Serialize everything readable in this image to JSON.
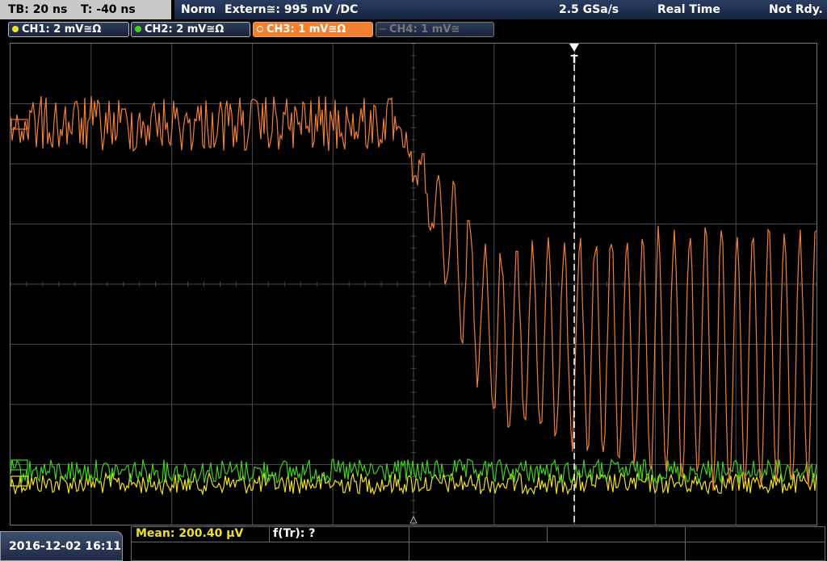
{
  "status": {
    "timebase": "TB: 20 ns",
    "trigger_time": "T: -40 ns",
    "trigger_mode": "Norm",
    "trigger_source": "Extern≅: 995 mV ∕DC",
    "sample_rate": "2.5 GSa/s",
    "acq_mode": "Real Time",
    "state": "Not Rdy."
  },
  "channels": [
    {
      "label": "CH1: 2 mV≅Ω",
      "color": "#f0e020",
      "active": true
    },
    {
      "label": "CH2: 2 mV≅Ω",
      "color": "#40d020",
      "active": true
    },
    {
      "label": "CH3: 1 mV≅Ω",
      "color": "#f28030",
      "active": true
    },
    {
      "label": "CH4: 1 mV≅",
      "color": "#777777",
      "active": false
    }
  ],
  "footer": {
    "timestamp": "2016-12-02 16:11",
    "measurement_1": "Mean: 200.40 µV",
    "measurement_2": "f(Tr): ?"
  },
  "colors": {
    "grid": "#4a4a4a",
    "ch1": "#f0e020",
    "ch2": "#40d020",
    "ch3": "#f28030",
    "trigger_marker": "#ffffff"
  },
  "icons": {
    "trigger_marker": "T-marker-icon",
    "channel_marker": "channel-ground-icon"
  }
}
